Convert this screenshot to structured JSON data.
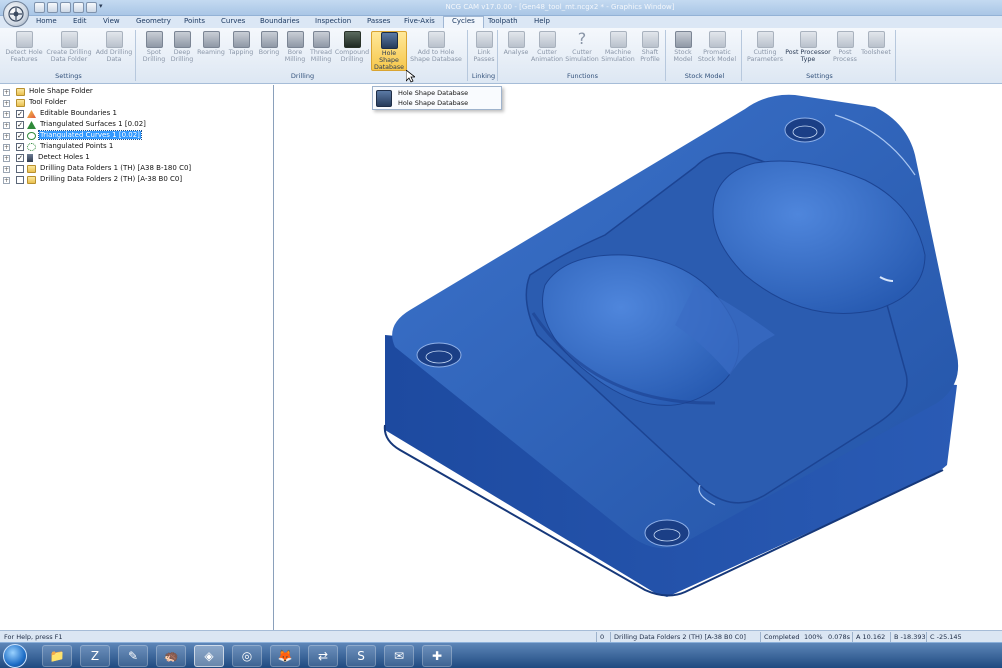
{
  "window": {
    "title": "NCG CAM v17.0.00 - [Gen48_tool_mt.ncgx2 *  - Graphics Window]",
    "logo_icon": "app-logo-icon"
  },
  "quick_access": [
    {
      "name": "new-icon"
    },
    {
      "name": "open-icon"
    },
    {
      "name": "save-icon"
    },
    {
      "name": "print-icon"
    },
    {
      "name": "undo-icon"
    },
    {
      "name": "redo-icon"
    }
  ],
  "menu": [
    "Home",
    "Edit",
    "View",
    "Geometry",
    "Points",
    "Curves",
    "Boundaries",
    "Inspection",
    "Passes",
    "Five-Axis",
    "Cycles",
    "Toolpath",
    "Help"
  ],
  "menu_active": "Cycles",
  "ribbon": {
    "groups": [
      {
        "label": "Settings",
        "buttons": [
          {
            "l1": "Detect Hole",
            "l2": "Features"
          },
          {
            "l1": "Create Drilling",
            "l2": "Data Folder"
          },
          {
            "l1": "Add Drilling",
            "l2": "Data"
          }
        ]
      },
      {
        "label": "Drilling",
        "buttons": [
          {
            "l1": "Spot",
            "l2": "Drilling"
          },
          {
            "l1": "Deep",
            "l2": "Drilling"
          },
          {
            "l1": "Reaming",
            "l2": ""
          },
          {
            "l1": "Tapping",
            "l2": ""
          },
          {
            "l1": "Boring",
            "l2": ""
          },
          {
            "l1": "Bore",
            "l2": "Milling"
          },
          {
            "l1": "Thread",
            "l2": "Milling"
          },
          {
            "l1": "Compound",
            "l2": "Drilling"
          },
          {
            "l1": "Hole Shape",
            "l2": "Database"
          },
          {
            "l1": "Add to Hole",
            "l2": "Shape Database"
          }
        ]
      },
      {
        "label": "Linking",
        "buttons": [
          {
            "l1": "Link",
            "l2": "Passes"
          }
        ]
      },
      {
        "label": "Functions",
        "buttons": [
          {
            "l1": "Analyse",
            "l2": ""
          },
          {
            "l1": "Cutter",
            "l2": "Animation"
          },
          {
            "l1": "Cutter",
            "l2": "Simulation"
          },
          {
            "l1": "Machine",
            "l2": "Simulation"
          },
          {
            "l1": "Shaft",
            "l2": "Profile"
          }
        ]
      },
      {
        "label": "Stock Model",
        "buttons": [
          {
            "l1": "Stock",
            "l2": "Model"
          },
          {
            "l1": "Promatic",
            "l2": "Stock Model"
          }
        ]
      },
      {
        "label": "Settings",
        "buttons": [
          {
            "l1": "Cutting",
            "l2": "Parameters"
          },
          {
            "l1": "Post Processor",
            "l2": "Type"
          },
          {
            "l1": "Post",
            "l2": "Process"
          },
          {
            "l1": "Toolsheet",
            "l2": ""
          }
        ]
      }
    ]
  },
  "dropdown": {
    "item1": "Hole Shape Database",
    "item2": "Hole Shape Database"
  },
  "tree": [
    {
      "label": "Hole Shape Folder",
      "checked": null,
      "icon": "folder-icon"
    },
    {
      "label": "Tool Folder",
      "checked": null,
      "icon": "folder-icon"
    },
    {
      "label": "Editable Boundaries 1",
      "checked": true,
      "icon": "boundary-icon"
    },
    {
      "label": "Triangulated Surfaces 1 [0.02]",
      "checked": true,
      "icon": "surface-icon"
    },
    {
      "label": "Triangulated Curves 1 [0.02]",
      "checked": true,
      "icon": "curve-icon",
      "selected": true
    },
    {
      "label": "Triangulated Points 1",
      "checked": true,
      "icon": "points-icon"
    },
    {
      "label": "Detect Holes 1",
      "checked": true,
      "icon": "detect-holes-icon"
    },
    {
      "label": "Drilling Data Folders 1 (TH) [A38 B-180 C0]",
      "checked": false,
      "icon": "drill-folder-icon"
    },
    {
      "label": "Drilling Data Folders 2 (TH) [A-38 B0 C0]",
      "checked": false,
      "icon": "drill-folder-icon"
    }
  ],
  "status": {
    "help": "For Help, press F1",
    "count": "0",
    "active_item": "Drilling Data Folders 2 (TH) [A-38 B0 C0]",
    "completed": "Completed",
    "percent": "100%",
    "time": "0.078s",
    "a": "A 10.162",
    "b": "B -18.393",
    "c": "C -25.145"
  },
  "taskbar": [
    {
      "name": "windows-explorer-icon",
      "glyph": "📁"
    },
    {
      "name": "filezilla-icon",
      "glyph": "Z"
    },
    {
      "name": "notepad-icon",
      "glyph": "✎"
    },
    {
      "name": "hedgehog-icon",
      "glyph": "🦔"
    },
    {
      "name": "ncg-app-icon",
      "glyph": "◈",
      "active": true
    },
    {
      "name": "generic-app-icon",
      "glyph": "◎"
    },
    {
      "name": "firefox-icon",
      "glyph": "🦊"
    },
    {
      "name": "teamviewer-icon",
      "glyph": "⇄"
    },
    {
      "name": "skype-icon",
      "glyph": "S"
    },
    {
      "name": "outlook-icon",
      "glyph": "✉"
    },
    {
      "name": "ncg-cam-icon",
      "glyph": "✚"
    }
  ],
  "colors": {
    "part_blue": "#2c5fb4",
    "selection": "#3399ff",
    "ribbon_active": "#f6c74b"
  }
}
